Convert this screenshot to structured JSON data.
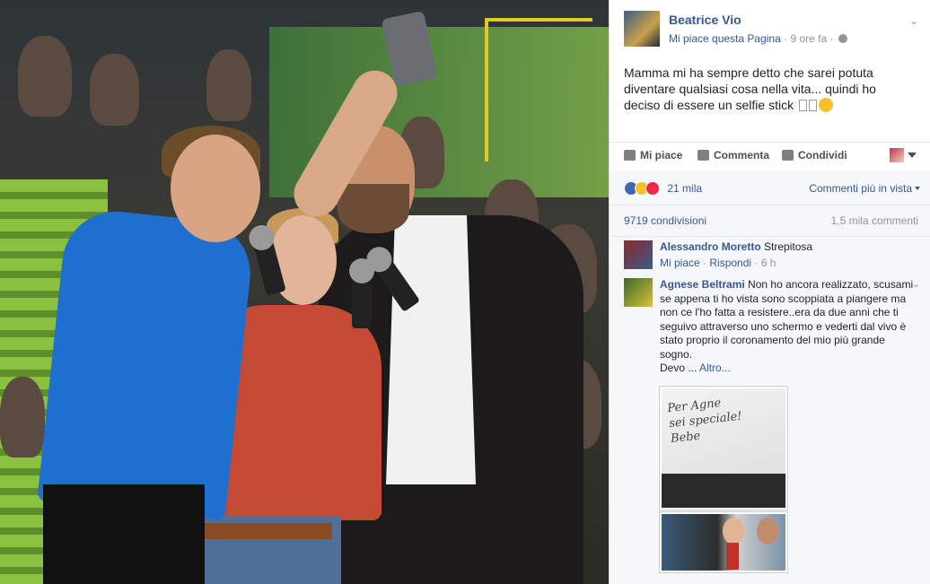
{
  "post": {
    "author": "Beatrice Vio",
    "like_page": "Mi piace questa Pagina",
    "time": "9 ore fa",
    "text": "Mamma mi ha sempre detto che sarei potuta diventare qualsiasi cosa nella vita... quindi ho deciso di essere un selfie stick"
  },
  "actions": {
    "like": "Mi piace",
    "comment": "Commenta",
    "share": "Condividi"
  },
  "ufi": {
    "reaction_count": "21 mila",
    "comments_order": "Commenti più in vista",
    "shares": "9719 condivisioni",
    "comments_total": "1,5 mila commenti"
  },
  "comments": [
    {
      "name": "Alessandro Moretto",
      "text": "Strepitosa",
      "like": "Mi piace",
      "reply": "Rispondi",
      "time": "6 h"
    },
    {
      "name": "Agnese Beltrami",
      "text": "Non ho ancora realizzato, scusami se appena ti ho vista sono scoppiata a piangere ma non ce l'ho fatta a resistere..era da due anni che ti seguivo attraverso uno schermo e vederti dal vivo è stato proprio il coronamento del mio più grande sogno.",
      "text2": "Devo ...",
      "more": "Altro...",
      "attachment_note": "Per Agne\nsei speciale!\nBebe"
    }
  ],
  "icons": {
    "like": "thumb-up-icon",
    "comment": "speech-bubble-icon",
    "share": "share-arrow-icon",
    "privacy": "globe-icon"
  },
  "colors": {
    "link": "#365899",
    "muted": "#90949c",
    "reaction_like": "#4267b2",
    "reaction_haha": "#f7c02b",
    "reaction_love": "#f0284a"
  }
}
